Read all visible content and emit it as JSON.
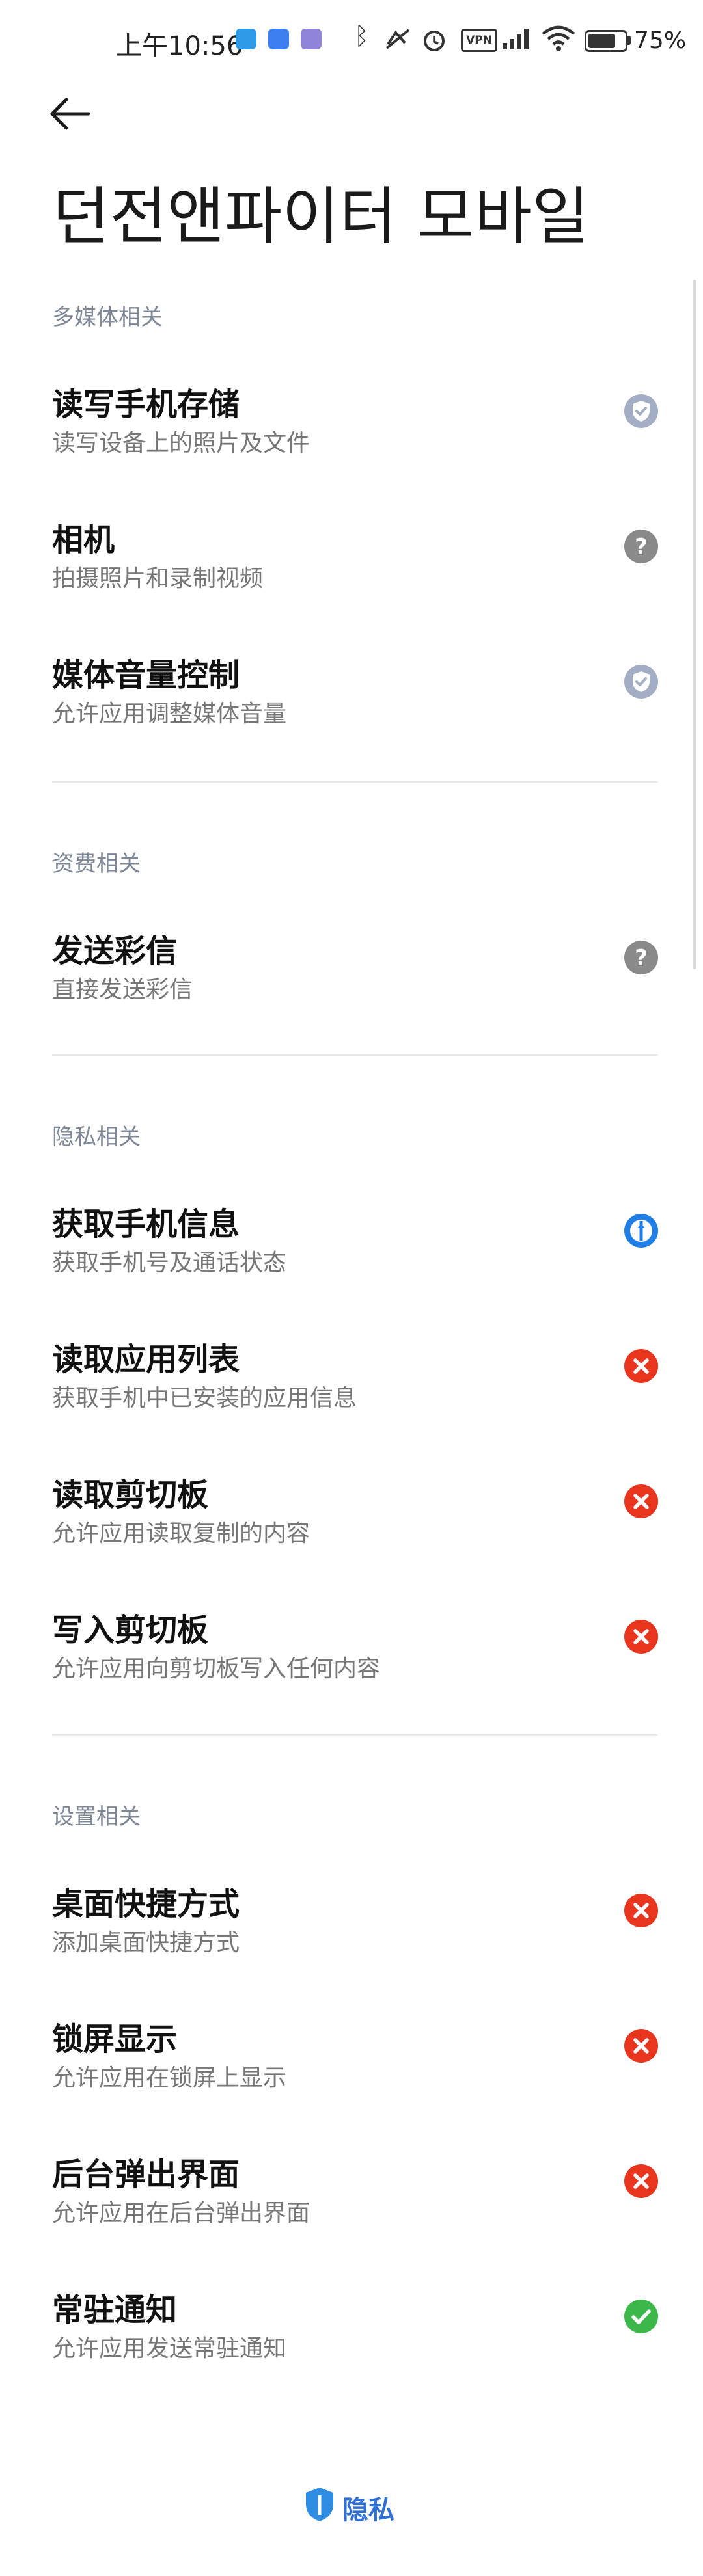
{
  "status_bar": {
    "time": "上午10:56",
    "vpn": "VPN",
    "battery": "75",
    "battery_suffix": "%"
  },
  "app": {
    "title": "던전앤파이터 모바일"
  },
  "sections": [
    {
      "header": "多媒体相关",
      "items": [
        {
          "title": "读写手机存储",
          "desc": "读写设备上的照片及文件",
          "status": "shield"
        },
        {
          "title": "相机",
          "desc": "拍摄照片和录制视频",
          "status": "ask"
        },
        {
          "title": "媒体音量控制",
          "desc": "允许应用调整媒体音量",
          "status": "shield"
        }
      ]
    },
    {
      "header": "资费相关",
      "items": [
        {
          "title": "发送彩信",
          "desc": "直接发送彩信",
          "status": "ask"
        }
      ]
    },
    {
      "header": "隐私相关",
      "items": [
        {
          "title": "获取手机信息",
          "desc": "获取手机号及通话状态",
          "status": "privacy"
        },
        {
          "title": "读取应用列表",
          "desc": "获取手机中已安装的应用信息",
          "status": "deny"
        },
        {
          "title": "读取剪切板",
          "desc": "允许应用读取复制的内容",
          "status": "deny"
        },
        {
          "title": "写入剪切板",
          "desc": "允许应用向剪切板写入任何内容",
          "status": "deny"
        }
      ]
    },
    {
      "header": "设置相关",
      "items": [
        {
          "title": "桌面快捷方式",
          "desc": "添加桌面快捷方式",
          "status": "deny"
        },
        {
          "title": "锁屏显示",
          "desc": "允许应用在锁屏上显示",
          "status": "deny"
        },
        {
          "title": "后台弹出界面",
          "desc": "允许应用在后台弹出界面",
          "status": "deny"
        },
        {
          "title": "常驻通知",
          "desc": "允许应用发送常驻通知",
          "status": "allow"
        }
      ]
    }
  ],
  "footer": {
    "label": "隐私"
  },
  "colors": {
    "deny": "#e8361e",
    "allow": "#3cb84a",
    "ask": "#8a8a8a",
    "shield": "#a3aec4",
    "privacy": "#1f7fe6",
    "section_header": "#7f8896"
  }
}
